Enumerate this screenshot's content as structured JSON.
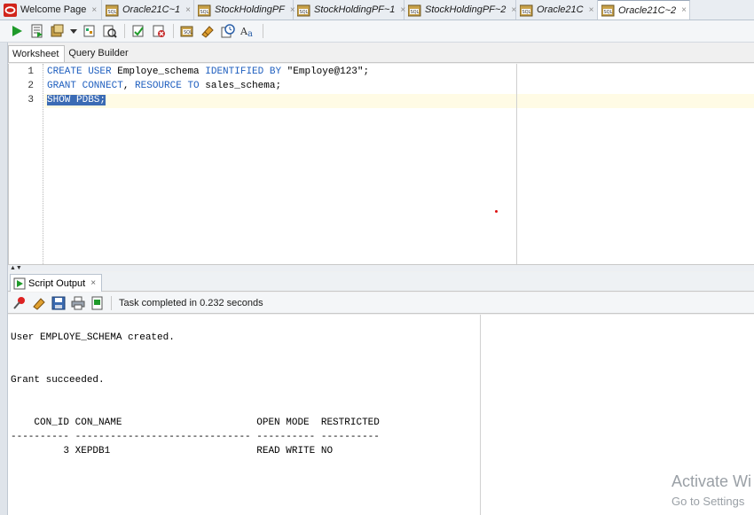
{
  "tabs": [
    {
      "label": "Welcome Page",
      "icon": "oracle-logo-icon",
      "width": 115
    },
    {
      "label": "Oracle21C~1",
      "icon": "sql-worksheet-icon",
      "width": 104
    },
    {
      "label": "StockHoldingPF",
      "icon": "sql-worksheet-icon",
      "width": 112
    },
    {
      "label": "StockHoldingPF~1",
      "icon": "sql-worksheet-icon",
      "width": 125
    },
    {
      "label": "StockHoldingPF~2",
      "icon": "sql-worksheet-icon",
      "width": 126
    },
    {
      "label": "Oracle21C",
      "icon": "sql-worksheet-icon",
      "width": 92
    },
    {
      "label": "Oracle21C~2",
      "icon": "sql-worksheet-icon",
      "width": 104
    }
  ],
  "close_glyph": "×",
  "subtabs": {
    "worksheet": "Worksheet",
    "query_builder": "Query Builder"
  },
  "editor": {
    "line_numbers": [
      "1",
      "2",
      "3"
    ],
    "lines": [
      [
        {
          "t": "CREATE USER",
          "k": true
        },
        {
          "t": " Employe_schema ",
          "k": false
        },
        {
          "t": "IDENTIFIED BY",
          "k": true
        },
        {
          "t": " \"Employe@123\";",
          "k": false
        }
      ],
      [
        {
          "t": "GRANT CONNECT",
          "k": true
        },
        {
          "t": ", ",
          "k": false
        },
        {
          "t": "RESOURCE TO",
          "k": true
        },
        {
          "t": " sales_schema;",
          "k": false
        }
      ],
      [
        {
          "t": "SHOW PDBS;",
          "k": false,
          "sel": true
        }
      ]
    ]
  },
  "output": {
    "tab_label": "Script Output",
    "status": "Task completed in 0.232 seconds",
    "text": "User EMPLOYE_SCHEMA created.\n\n\nGrant succeeded.\n\n\n    CON_ID CON_NAME                       OPEN MODE  RESTRICTED\n---------- ------------------------------ ---------- ----------\n         3 XEPDB1                         READ WRITE NO"
  },
  "watermark": {
    "line1": "Activate Wi",
    "line2": "Go to Settings"
  },
  "colors": {
    "keyword": "#1f5fbf",
    "selection": "#3b6bb4",
    "current_line": "#fffbe5",
    "run_green": "#1f9a2a"
  }
}
